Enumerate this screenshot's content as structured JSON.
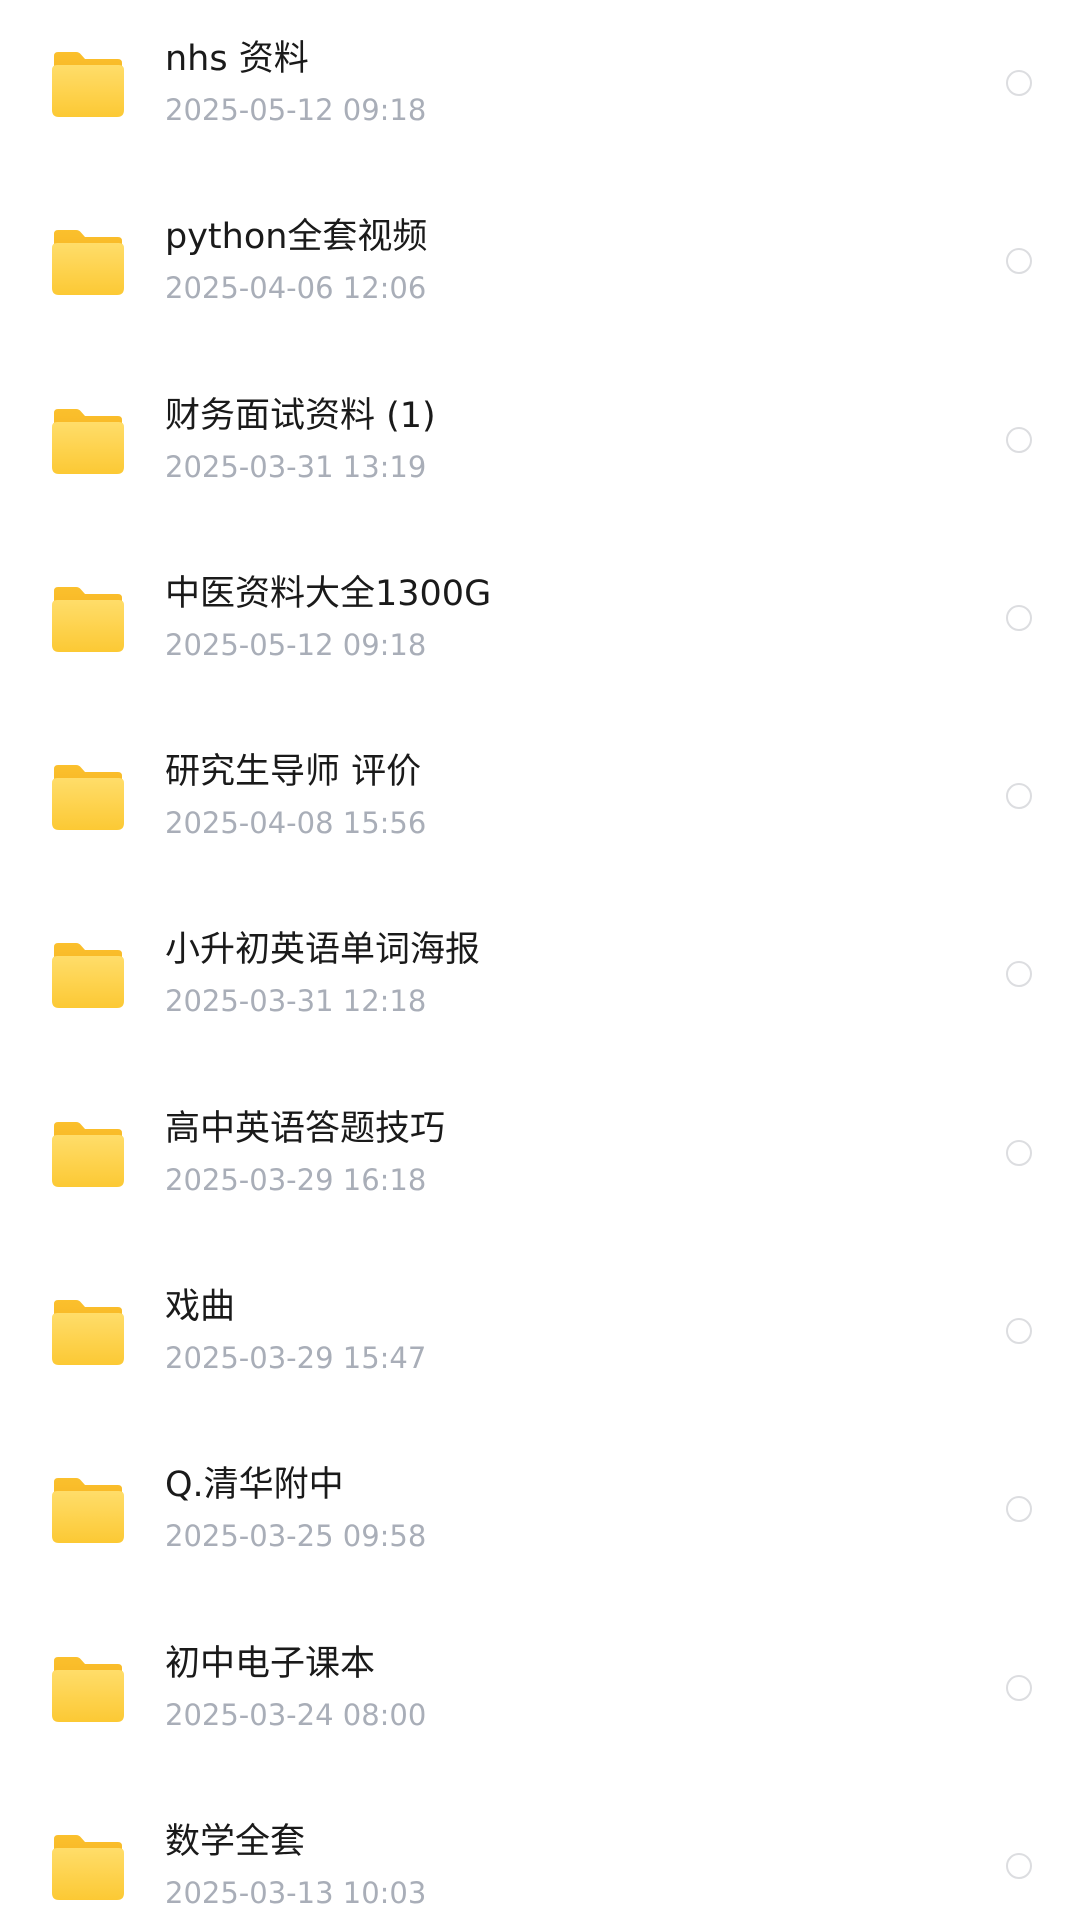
{
  "colors": {
    "folder_top": "#ffdd6a",
    "folder_bottom": "#fbc02d",
    "name_text": "#1a1a1a",
    "date_text": "#a9aeb8",
    "select_border": "#dcdde0"
  },
  "icons": {
    "folder": "folder-icon",
    "select": "radio-circle-icon"
  },
  "files": [
    {
      "name": "nhs 资料",
      "date": "2025-05-12 09:18"
    },
    {
      "name": "python全套视频",
      "date": "2025-04-06 12:06"
    },
    {
      "name": "财务面试资料 (1)",
      "date": "2025-03-31 13:19"
    },
    {
      "name": "中医资料大全1300G",
      "date": "2025-05-12 09:18"
    },
    {
      "name": "研究生导师 评价",
      "date": "2025-04-08 15:56"
    },
    {
      "name": "小升初英语单词海报",
      "date": "2025-03-31 12:18"
    },
    {
      "name": "高中英语答题技巧",
      "date": "2025-03-29 16:18"
    },
    {
      "name": "戏曲",
      "date": "2025-03-29 15:47"
    },
    {
      "name": "Q.清华附中",
      "date": "2025-03-25 09:58"
    },
    {
      "name": "初中电子课本",
      "date": "2025-03-24 08:00"
    },
    {
      "name": "数学全套",
      "date": "2025-03-13 10:03"
    }
  ]
}
